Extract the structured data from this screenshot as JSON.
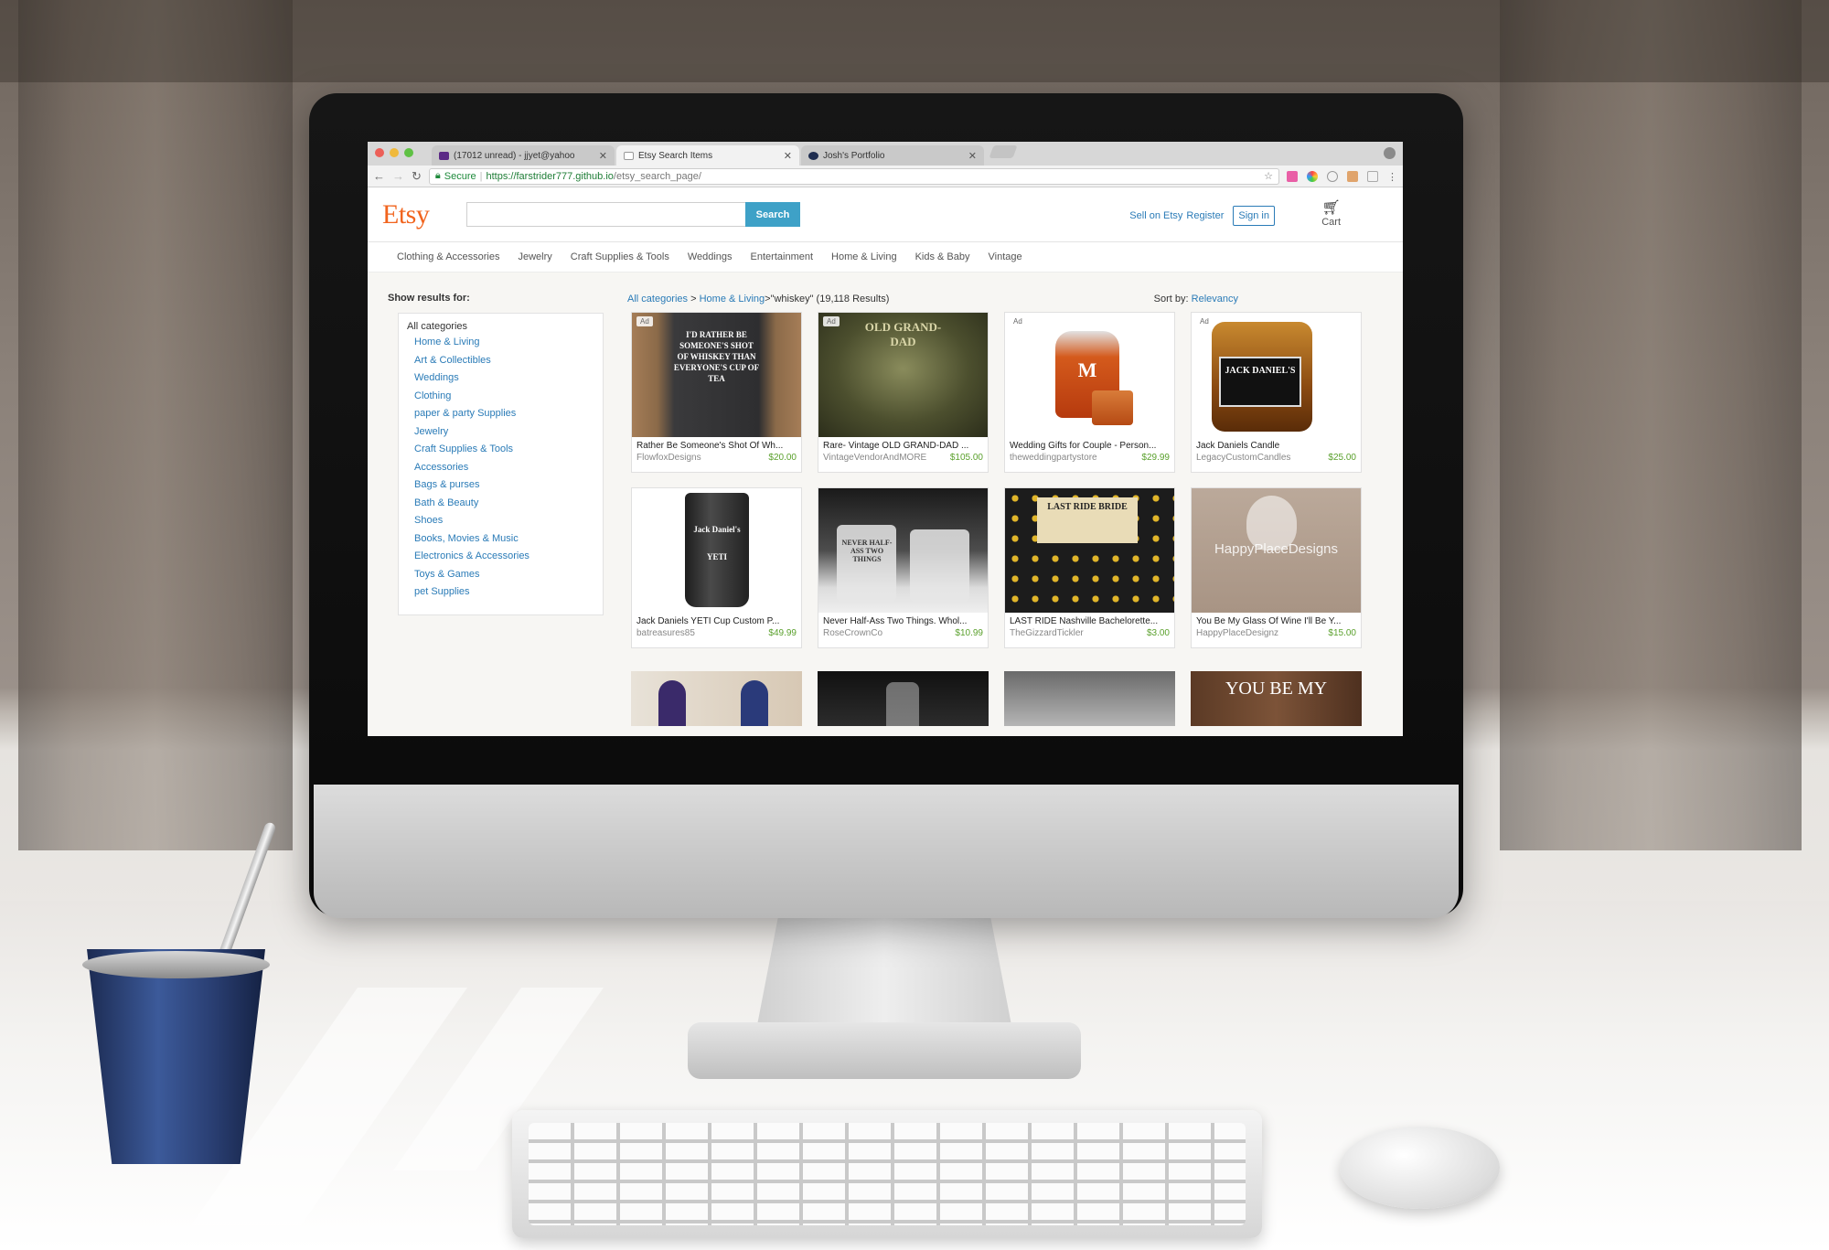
{
  "browser": {
    "tabs": [
      {
        "title": "(17012 unread) - jjyet@yahoo",
        "icon": "mail-icon",
        "color": "#5b2a86"
      },
      {
        "title": "Etsy Search Items",
        "icon": "page-icon",
        "color": "#999999"
      },
      {
        "title": "Josh's Portfolio",
        "icon": "portfolio-icon",
        "color": "#1f2d50"
      }
    ],
    "secure_label": "Secure",
    "url_host": "https://farstrider777.github.io",
    "url_path": "/etsy_search_page/"
  },
  "etsy": {
    "logo": "Etsy",
    "search": {
      "placeholder": "",
      "button": "Search"
    },
    "header_links": {
      "sell": "Sell on Etsy",
      "register": "Register",
      "signin": "Sign in",
      "cart": "Cart"
    },
    "categories": [
      "Clothing & Accessories",
      "Jewelry",
      "Craft Supplies & Tools",
      "Weddings",
      "Entertainment",
      "Home & Living",
      "Kids & Baby",
      "Vintage"
    ],
    "sidebar": {
      "title": "Show results for:",
      "all": "All categories",
      "items": [
        "Home & Living",
        "Art & Collectibles",
        "Weddings",
        "Clothing",
        "paper & party Supplies",
        "Jewelry",
        "Craft Supplies & Tools",
        "Accessories",
        "Bags & purses",
        "Bath & Beauty",
        "Shoes",
        "Books, Movies & Music",
        "Electronics & Accessories",
        "Toys & Games",
        "pet Supplies"
      ]
    },
    "results": {
      "crumb1": "All categories",
      "sep1": " > ",
      "crumb2": "Home & Living",
      "query": " >\"whiskey\" (19,118 Results)",
      "sort_label": "Sort by: ",
      "sort_value": "Relevancy"
    },
    "listings": [
      {
        "title": "Rather Be Someone's Shot Of Wh...",
        "shop": "FlowfoxDesigns",
        "price": "$20.00",
        "ad": "Ad",
        "thumb_text": "I'D RATHER BE SOMEONE'S SHOT OF WHISKEY THAN EVERYONE'S CUP OF TEA"
      },
      {
        "title": "Rare- Vintage OLD GRAND-DAD ...",
        "shop": "VintageVendorAndMORE",
        "price": "$105.00",
        "ad": "Ad",
        "thumb_text": "OLD GRAND-DAD"
      },
      {
        "title": "Wedding Gifts for Couple - Person...",
        "shop": "theweddingpartystore",
        "price": "$29.99",
        "ad": "Ad",
        "thumb_text": "M"
      },
      {
        "title": "Jack Daniels Candle",
        "shop": "LegacyCustomCandles",
        "price": "$25.00",
        "ad": "Ad",
        "thumb_text": "JACK DANIEL'S"
      },
      {
        "title": "Jack Daniels YETI Cup Custom P...",
        "shop": "batreasures85",
        "price": "$49.99",
        "ad": "",
        "thumb_text": "Jack Daniel's YETI"
      },
      {
        "title": "Never Half-Ass Two Things. Whol...",
        "shop": "RoseCrownCo",
        "price": "$10.99",
        "ad": "",
        "thumb_text": "NEVER HALF-ASS TWO THINGS"
      },
      {
        "title": "LAST RIDE Nashville Bachelorette...",
        "shop": "TheGizzardTickler",
        "price": "$3.00",
        "ad": "",
        "thumb_text": "LAST RIDE BRIDE"
      },
      {
        "title": "You Be My Glass Of Wine I'll Be Y...",
        "shop": "HappyPlaceDesignz",
        "price": "$15.00",
        "ad": "",
        "thumb_text": "HappyPlaceDesigns"
      }
    ],
    "partial_row_text": "YOU BE MY"
  }
}
